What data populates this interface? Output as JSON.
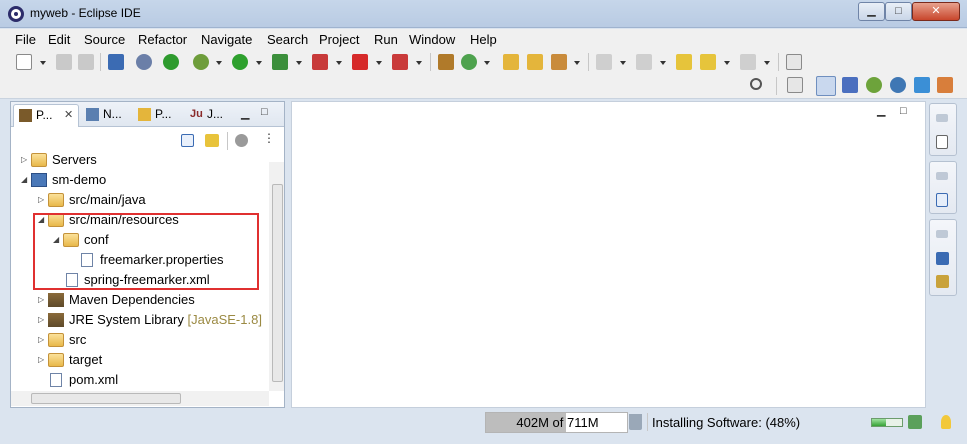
{
  "window": {
    "title": "myweb - Eclipse IDE",
    "minimize_label": "▁",
    "maximize_label": "□",
    "close_label": "✕"
  },
  "menubar": [
    "File",
    "Edit",
    "Source",
    "Refactor",
    "Navigate",
    "Search",
    "Project",
    "Run",
    "Window",
    "Help"
  ],
  "left_panel": {
    "tabs": [
      {
        "label": "P...",
        "icon": "package-explorer-icon",
        "close": "✕"
      },
      {
        "label": "N...",
        "icon": "navigator-icon"
      },
      {
        "label": "P...",
        "icon": "project-explorer-icon"
      },
      {
        "label": "J...",
        "icon": "junit-icon"
      }
    ],
    "tree": [
      {
        "label": "Servers",
        "icon": "folder-icon",
        "twisty": "▷"
      },
      {
        "label": "sm-demo",
        "icon": "maven-project-icon",
        "twisty": "◢"
      },
      {
        "label": "src/main/java",
        "icon": "source-folder-icon",
        "twisty": "▷"
      },
      {
        "label": "src/main/resources",
        "icon": "source-folder-icon",
        "twisty": "◢"
      },
      {
        "label": "conf",
        "icon": "folder-icon",
        "twisty": "◢"
      },
      {
        "label": "freemarker.properties",
        "icon": "properties-file-icon"
      },
      {
        "label": "spring-freemarker.xml",
        "icon": "xml-file-icon"
      },
      {
        "label": "Maven Dependencies",
        "icon": "library-icon",
        "twisty": "▷"
      },
      {
        "label": "JRE System Library",
        "decoration": "[JavaSE-1.8]",
        "icon": "library-icon",
        "twisty": "▷"
      },
      {
        "label": "src",
        "icon": "folder-icon",
        "twisty": "▷"
      },
      {
        "label": "target",
        "icon": "folder-icon",
        "twisty": "▷"
      },
      {
        "label": "pom.xml",
        "icon": "maven-pom-icon"
      }
    ]
  },
  "statusbar": {
    "heap_text": "402M of 711M",
    "heap_fraction": 0.57,
    "status_text": "Installing Software: (48%)",
    "progress_fraction": 0.48
  },
  "colors": {
    "accent": "#e03030",
    "window_bg": "#dbe4ef",
    "titlebar": "#c6d6ea"
  }
}
